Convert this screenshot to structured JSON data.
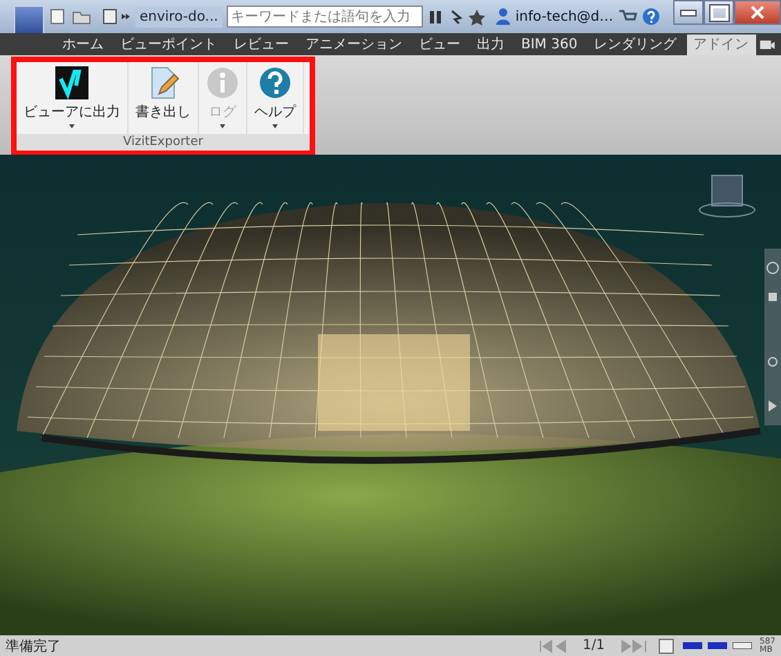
{
  "window": {
    "document_title": "enviro-do...",
    "search": {
      "placeholder": "キーワードまたは語句を入力"
    },
    "user": "info-tech@d…"
  },
  "tabs": [
    {
      "label": "ホーム",
      "selected": false
    },
    {
      "label": "ビューポイント",
      "selected": false
    },
    {
      "label": "レビュー",
      "selected": false
    },
    {
      "label": "アニメーション",
      "selected": false
    },
    {
      "label": "ビュー",
      "selected": false
    },
    {
      "label": "出力",
      "selected": false
    },
    {
      "label": "BIM 360",
      "selected": false
    },
    {
      "label": "レンダリング",
      "selected": false
    },
    {
      "label": "アドイン",
      "selected": true
    }
  ],
  "ribbon": {
    "group": "VizitExporter",
    "highlighted": true,
    "buttons": [
      {
        "label": "ビューアに出力",
        "kind": "viewer",
        "dropdown": true,
        "disabled": false
      },
      {
        "label": "書き出し",
        "kind": "export",
        "dropdown": false,
        "disabled": false
      },
      {
        "label": "ログ",
        "kind": "info",
        "dropdown": true,
        "disabled": true
      },
      {
        "label": "ヘルプ",
        "kind": "help",
        "dropdown": true,
        "disabled": false
      }
    ]
  },
  "status_bar": {
    "text": "準備完了",
    "page": "1/1",
    "memory": "587",
    "memory_unit": "MB"
  }
}
